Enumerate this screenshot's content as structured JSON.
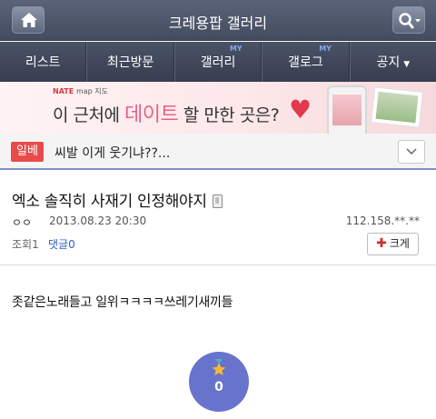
{
  "header": {
    "title": "크레용팝 갤러리",
    "home_icon": "home-icon",
    "search_icon": "search-icon"
  },
  "nav": {
    "items": [
      {
        "label": "리스트",
        "badge": ""
      },
      {
        "label": "최근방문",
        "badge": ""
      },
      {
        "label": "갤러리",
        "badge": "MY"
      },
      {
        "label": "갤로그",
        "badge": "MY"
      },
      {
        "label": "공지",
        "badge": ""
      }
    ]
  },
  "banner": {
    "top_brand": "NATE",
    "top_sub": "map 지도",
    "text_before": "이 근처에",
    "text_highlight": "데이트",
    "text_after": "할 만한 곳은?"
  },
  "notice": {
    "badge": "일베",
    "text": "씨발 이게 웃기냐??..."
  },
  "post": {
    "title": "엑소 솔직히 사재기 인정해야지",
    "author": "ㅇㅇ",
    "date": "2013.08.23 20:30",
    "ip": "112.158.**.**",
    "views_label": "조회1",
    "comments_label": "댓글0",
    "size_button": "크게",
    "body": "좃같은노래들고 일위ㅋㅋㅋㅋ쓰레기새끼들",
    "recommend_count": "0"
  },
  "colors": {
    "header_bg": "#4f576b",
    "notice_badge": "#e94b4b",
    "comments_link": "#2b62c4",
    "recommend_bg": "#6874cc",
    "divider_accent": "#7f8fc9"
  }
}
